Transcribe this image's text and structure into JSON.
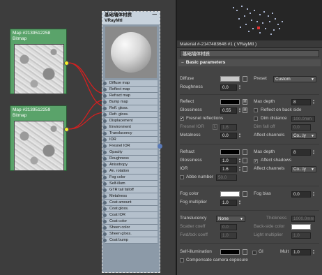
{
  "nodes": {
    "map1": {
      "title": "Map #2139512258",
      "subtitle": "Bitmap"
    },
    "map2": {
      "title": "Map #2139512259",
      "subtitle": "Bitmap"
    },
    "vray": {
      "title": "基础墙体材质",
      "subtitle": "VRayMtl",
      "collapse": "—",
      "slots": [
        "Diffuse map",
        "Reflect map",
        "Refract map",
        "Bump map",
        "Refl. gloss.",
        "Refr. gloss.",
        "Displacement",
        "Environment",
        "Translucency",
        "IOR",
        "Fresnel IOR",
        "Opacity",
        "Roughness",
        "Anisotropy",
        "An. rotation",
        "Fog color",
        "Self-illum",
        "GTR tail falloff",
        "Metalness",
        "Coat amount",
        "Coat gloss.",
        "Coat IOR",
        "Coat color",
        "Sheen color",
        "Sheen gloss.",
        "Coat bump"
      ]
    }
  },
  "panel": {
    "title": "Material #-2147483648 #1  ( VRayMtl )",
    "name": "基础墙体材质",
    "rollout": "Basic parameters",
    "rollout_sign": "–",
    "diffuse": {
      "label": "Diffuse",
      "m": "",
      "color": "#c8c8c8"
    },
    "preset": {
      "label": "Preset",
      "value": "Custom"
    },
    "roughness": {
      "label": "Roughness",
      "value": "0.0"
    },
    "reflect": {
      "label": "Reflect",
      "m": "M",
      "color": "#000000"
    },
    "glossiness": {
      "label": "Glossiness",
      "value": "0.55",
      "m": "M"
    },
    "max_depth1": {
      "label": "Max depth",
      "value": "8"
    },
    "reflect_backside": {
      "label": "Reflect on back side",
      "checked": ""
    },
    "fresnel": {
      "label": "Fresnel reflections",
      "checked": "✔"
    },
    "dim_distance": {
      "label": "Dim distance",
      "value": "100.0mm",
      "checked": ""
    },
    "fresnel_ior": {
      "label": "Fresnel IOR",
      "l": "L",
      "value": "1.6"
    },
    "dim_falloff": {
      "label": "Dim fall off",
      "value": "0.0"
    },
    "metalness": {
      "label": "Metalness",
      "value": "0.0"
    },
    "affect_channels1": {
      "label": "Affect channels",
      "value": "Co...ly"
    },
    "refract": {
      "label": "Refract",
      "color": "#000000"
    },
    "max_depth2": {
      "label": "Max depth",
      "value": "8"
    },
    "glossiness2": {
      "label": "Glossiness",
      "value": "1.0"
    },
    "affect_shadows": {
      "label": "Affect shadows",
      "checked": "✔"
    },
    "ior": {
      "label": "IOR",
      "value": "1.6"
    },
    "affect_channels2": {
      "label": "Affect channels",
      "value": "Co...ly"
    },
    "abbe": {
      "label": "Abbe number",
      "value": "50.0",
      "checked": ""
    },
    "fog_color": {
      "label": "Fog color",
      "color": "#ffffff"
    },
    "fog_bias": {
      "label": "Fog bias",
      "value": "0.0"
    },
    "fog_multiplier": {
      "label": "Fog multiplier",
      "value": "1.0"
    },
    "translucency": {
      "label": "Translucency",
      "value": "None"
    },
    "thickness": {
      "label": "Thickness",
      "value": "1000.0mm"
    },
    "scatter_coeff": {
      "label": "Scatter coeff",
      "value": "0.0"
    },
    "backside_color": {
      "label": "Back-side color",
      "color": "#ffffff"
    },
    "fwd_bck_coeff": {
      "label": "Fwd/bck coeff",
      "value": "1.0"
    },
    "light_multiplier": {
      "label": "Light multiplier",
      "value": "1.0"
    },
    "self_illum": {
      "label": "Self-illumination",
      "color": "#000000"
    },
    "gi": {
      "label": "GI",
      "checked": ""
    },
    "mult": {
      "label": "Mult",
      "value": "1.0"
    },
    "compensate": {
      "label": "Compensate camera exposure",
      "checked": ""
    }
  }
}
